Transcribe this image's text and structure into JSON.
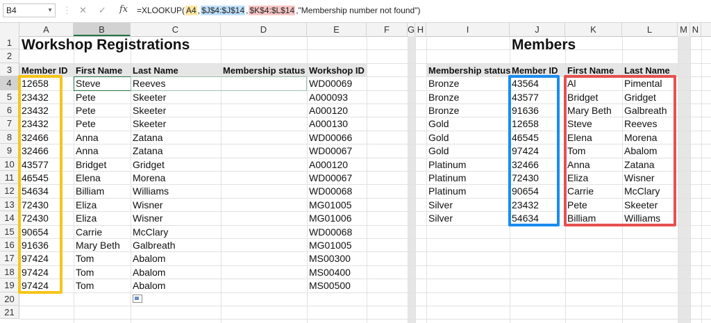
{
  "formula_bar": {
    "name_box": "B4",
    "cancel_icon": "✕",
    "enter_icon": "✓",
    "fx_label": "fx",
    "formula_parts": [
      {
        "text": "=XLOOKUP(",
        "hl": ""
      },
      {
        "text": "A4",
        "hl": "r1"
      },
      {
        "text": ",",
        "hl": ""
      },
      {
        "text": "$J$4:$J$14",
        "hl": "r2"
      },
      {
        "text": ",",
        "hl": ""
      },
      {
        "text": "$K$4:$L$14",
        "hl": "r3"
      },
      {
        "text": ",\"Membership number not found\")",
        "hl": ""
      }
    ]
  },
  "columns": [
    "A",
    "B",
    "C",
    "D",
    "E",
    "F",
    "G",
    "H",
    "I",
    "J",
    "K",
    "L",
    "M",
    "N"
  ],
  "rows": [
    "1",
    "2",
    "3",
    "4",
    "5",
    "6",
    "7",
    "8",
    "9",
    "10",
    "11",
    "12",
    "13",
    "14",
    "15",
    "16",
    "17",
    "18",
    "19",
    "20",
    "21"
  ],
  "selection": {
    "column": "B",
    "row": "4"
  },
  "left_table": {
    "title": "Workshop Registrations",
    "headers": [
      "Member ID",
      "First Name",
      "Last Name",
      "Membership status",
      "Workshop ID"
    ],
    "rows": [
      [
        "12658",
        "Steve",
        "Reeves",
        "",
        "WD00069"
      ],
      [
        "23432",
        "Pete",
        "Skeeter",
        "",
        "A000093"
      ],
      [
        "23432",
        "Pete",
        "Skeeter",
        "",
        "A000120"
      ],
      [
        "23432",
        "Pete",
        "Skeeter",
        "",
        "A000130"
      ],
      [
        "32466",
        "Anna",
        "Zatana",
        "",
        "WD00066"
      ],
      [
        "32466",
        "Anna",
        "Zatana",
        "",
        "WD00067"
      ],
      [
        "43577",
        "Bridget",
        "Gridget",
        "",
        "A000120"
      ],
      [
        "46545",
        "Elena",
        "Morena",
        "",
        "WD00067"
      ],
      [
        "54634",
        "Billiam",
        "Williams",
        "",
        "WD00068"
      ],
      [
        "72430",
        "Eliza",
        "Wisner",
        "",
        "MG01005"
      ],
      [
        "72430",
        "Eliza",
        "Wisner",
        "",
        "MG01006"
      ],
      [
        "90654",
        "Carrie",
        "McClary",
        "",
        "WD00068"
      ],
      [
        "91636",
        "Mary Beth",
        "Galbreath",
        "",
        "MG01005"
      ],
      [
        "97424",
        "Tom",
        "Abalom",
        "",
        "MS00300"
      ],
      [
        "97424",
        "Tom",
        "Abalom",
        "",
        "MS00400"
      ],
      [
        "97424",
        "Tom",
        "Abalom",
        "",
        "MS00500"
      ]
    ]
  },
  "right_table": {
    "title": "Members",
    "headers": [
      "Membership status",
      "Member ID",
      "First Name",
      "Last Name"
    ],
    "rows": [
      [
        "Bronze",
        "43564",
        "Al",
        "Pimental"
      ],
      [
        "Bronze",
        "43577",
        "Bridget",
        "Gridget"
      ],
      [
        "Bronze",
        "91636",
        "Mary Beth",
        "Galbreath"
      ],
      [
        "Gold",
        "12658",
        "Steve",
        "Reeves"
      ],
      [
        "Gold",
        "46545",
        "Elena",
        "Morena"
      ],
      [
        "Gold",
        "97424",
        "Tom",
        "Abalom"
      ],
      [
        "Platinum",
        "32466",
        "Anna",
        "Zatana"
      ],
      [
        "Platinum",
        "72430",
        "Eliza",
        "Wisner"
      ],
      [
        "Platinum",
        "90654",
        "Carrie",
        "McClary"
      ],
      [
        "Silver",
        "23432",
        "Pete",
        "Skeeter"
      ],
      [
        "Silver",
        "54634",
        "Billiam",
        "Williams"
      ]
    ]
  },
  "colors": {
    "lookup_value_box": "#f5c518",
    "lookup_array_box": "#1a8cf0",
    "return_array_box": "#e65050",
    "header_band": "#e6e6e6",
    "selection_accent": "#217346"
  },
  "icons": {
    "paste_options": "paste-options-icon"
  }
}
